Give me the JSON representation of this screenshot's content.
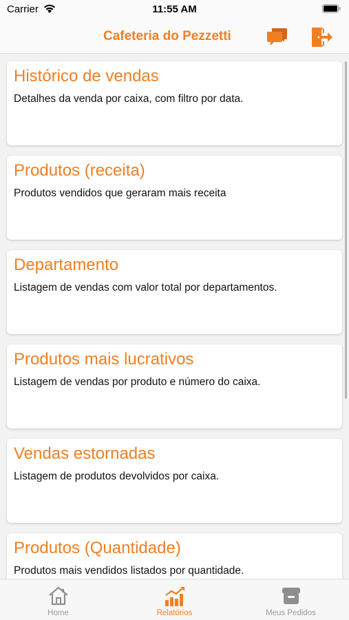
{
  "status": {
    "carrier": "Carrier",
    "time": "11:55 AM"
  },
  "nav": {
    "title": "Cafeteria do Pezzetti",
    "chat_icon": "chat-bubbles-icon",
    "logout_icon": "logout-icon"
  },
  "reports": [
    {
      "title": "Histórico de vendas",
      "description": "Detalhes da venda por caixa, com filtro por data."
    },
    {
      "title": "Produtos (receita)",
      "description": "Produtos vendidos que geraram mais receita"
    },
    {
      "title": "Departamento",
      "description": "Listagem de vendas com valor total por departamentos."
    },
    {
      "title": "Produtos mais lucrativos",
      "description": "Listagem de vendas por produto e número do caixa."
    },
    {
      "title": "Vendas estornadas",
      "description": "Listagem de produtos devolvidos por caixa."
    },
    {
      "title": "Produtos (Quantidade)",
      "description": "Produtos mais vendidos listados por quantidade."
    }
  ],
  "tabs": [
    {
      "label": "Home",
      "icon": "home-icon",
      "active": false
    },
    {
      "label": "Relatórios",
      "icon": "bar-chart-icon",
      "active": true
    },
    {
      "label": "Meus Pedidos",
      "icon": "orders-box-icon",
      "active": false
    }
  ],
  "colors": {
    "accent": "#f07f23",
    "inactive": "#9a9a9a",
    "background": "#f2f2f2",
    "card": "#ffffff"
  }
}
